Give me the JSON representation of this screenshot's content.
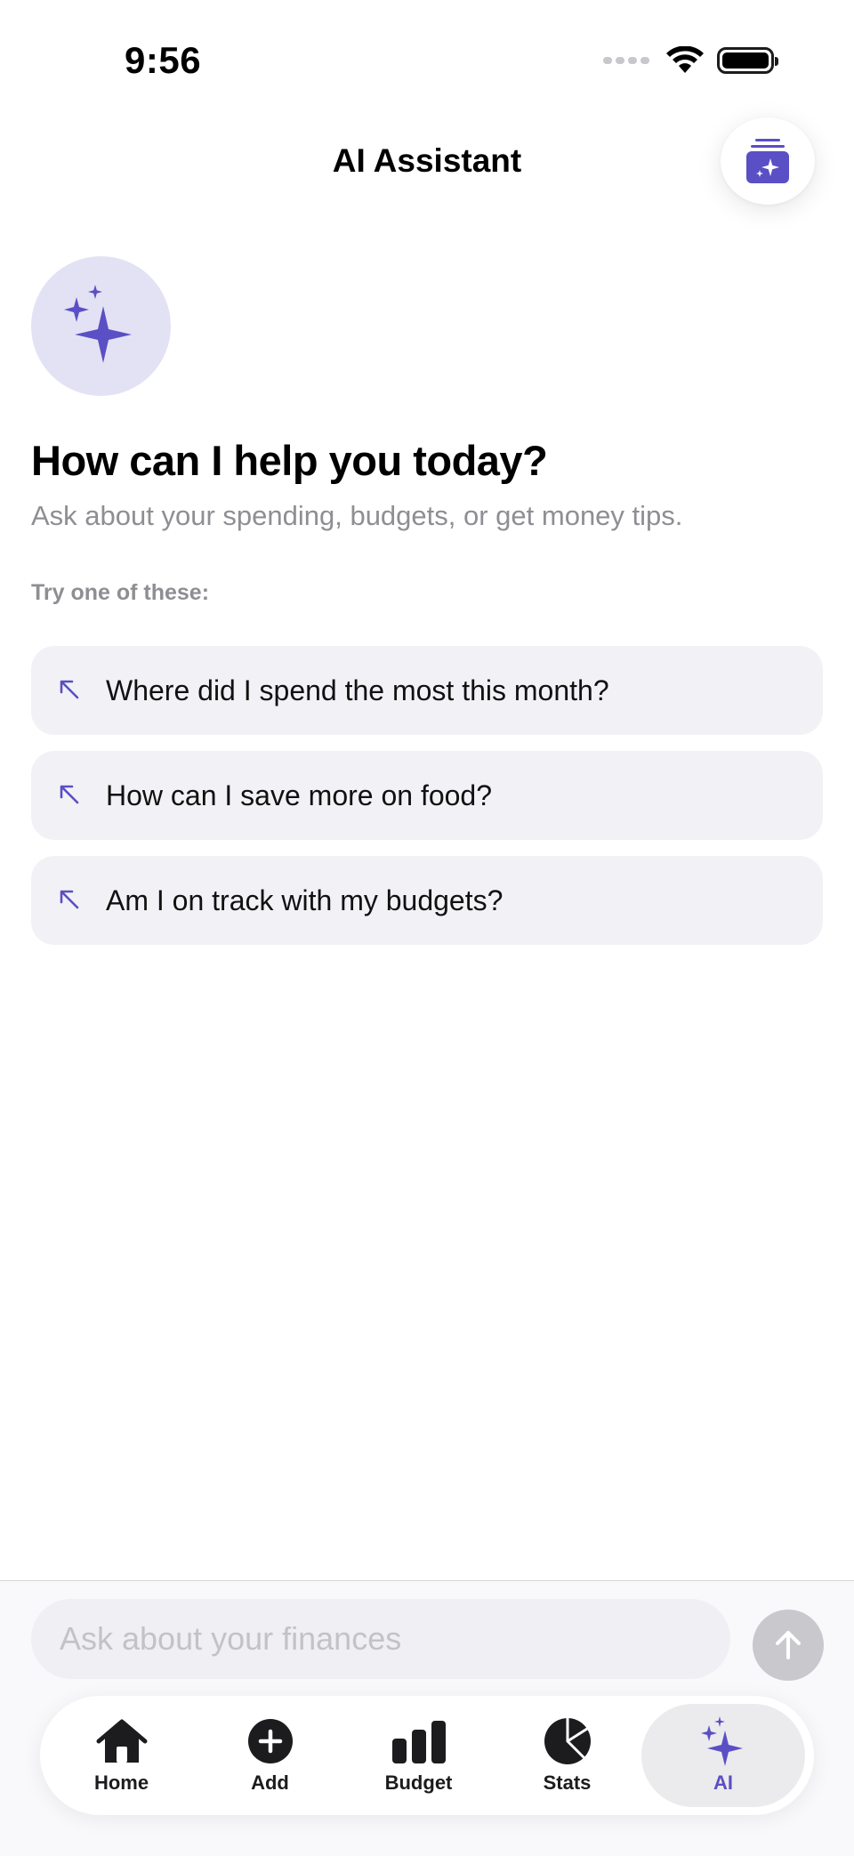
{
  "status_bar": {
    "time": "9:56"
  },
  "header": {
    "title": "AI Assistant"
  },
  "hero": {
    "title": "How can I help you today?",
    "subtitle": "Ask about your spending, budgets, or get money tips.",
    "try_label": "Try one of these:"
  },
  "suggestions": [
    {
      "text": "Where did I spend the most this month?"
    },
    {
      "text": "How can I save more on food?"
    },
    {
      "text": "Am I on track with my budgets?"
    }
  ],
  "chat_input": {
    "placeholder": "Ask about your finances",
    "value": ""
  },
  "tabs": [
    {
      "label": "Home",
      "icon": "home-icon",
      "active": false
    },
    {
      "label": "Add",
      "icon": "plus-circle-icon",
      "active": false
    },
    {
      "label": "Budget",
      "icon": "bar-chart-icon",
      "active": false
    },
    {
      "label": "Stats",
      "icon": "pie-chart-icon",
      "active": false
    },
    {
      "label": "AI",
      "icon": "sparkles-icon",
      "active": true
    }
  ],
  "colors": {
    "accent": "#5a4fc4",
    "hero_bg": "#e3e2f4",
    "suggestion_bg": "#f2f2f6",
    "secondary_text": "#8e8e93"
  }
}
